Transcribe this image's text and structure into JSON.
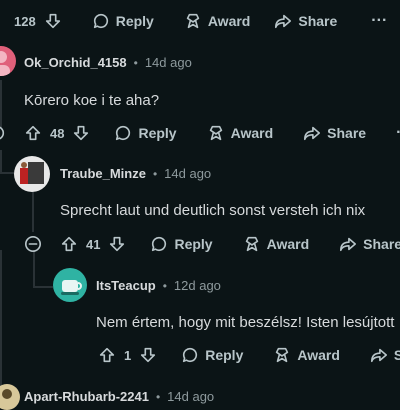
{
  "top_actions": {
    "votes": "128",
    "reply": "Reply",
    "award": "Award",
    "share": "Share"
  },
  "comments": [
    {
      "author": "Ok_Orchid_4158",
      "time": "14d ago",
      "text": "Kōrero koe i te aha?",
      "votes": "48",
      "reply": "Reply",
      "award": "Award",
      "share": "Share"
    },
    {
      "author": "Traube_Minze",
      "time": "14d ago",
      "text": "Sprecht laut und deutlich sonst versteh ich nix",
      "votes": "41",
      "reply": "Reply",
      "award": "Award",
      "share": "Share"
    },
    {
      "author": "ItsTeacup",
      "time": "12d ago",
      "text": "Nem értem, hogy mit beszélsz! Isten lesújtott",
      "votes": "1",
      "reply": "Reply",
      "award": "Award",
      "share": "S"
    },
    {
      "author": "Apart-Rhubarb-2241",
      "time": "14d ago"
    }
  ],
  "colors": {
    "background": "#0b1416",
    "text": "#d7dadc",
    "muted": "#8e9a9d",
    "thread": "#2a3236"
  },
  "icons": [
    "upvote-icon",
    "downvote-icon",
    "reply-icon",
    "award-icon",
    "share-icon",
    "more-icon",
    "collapse-icon"
  ]
}
